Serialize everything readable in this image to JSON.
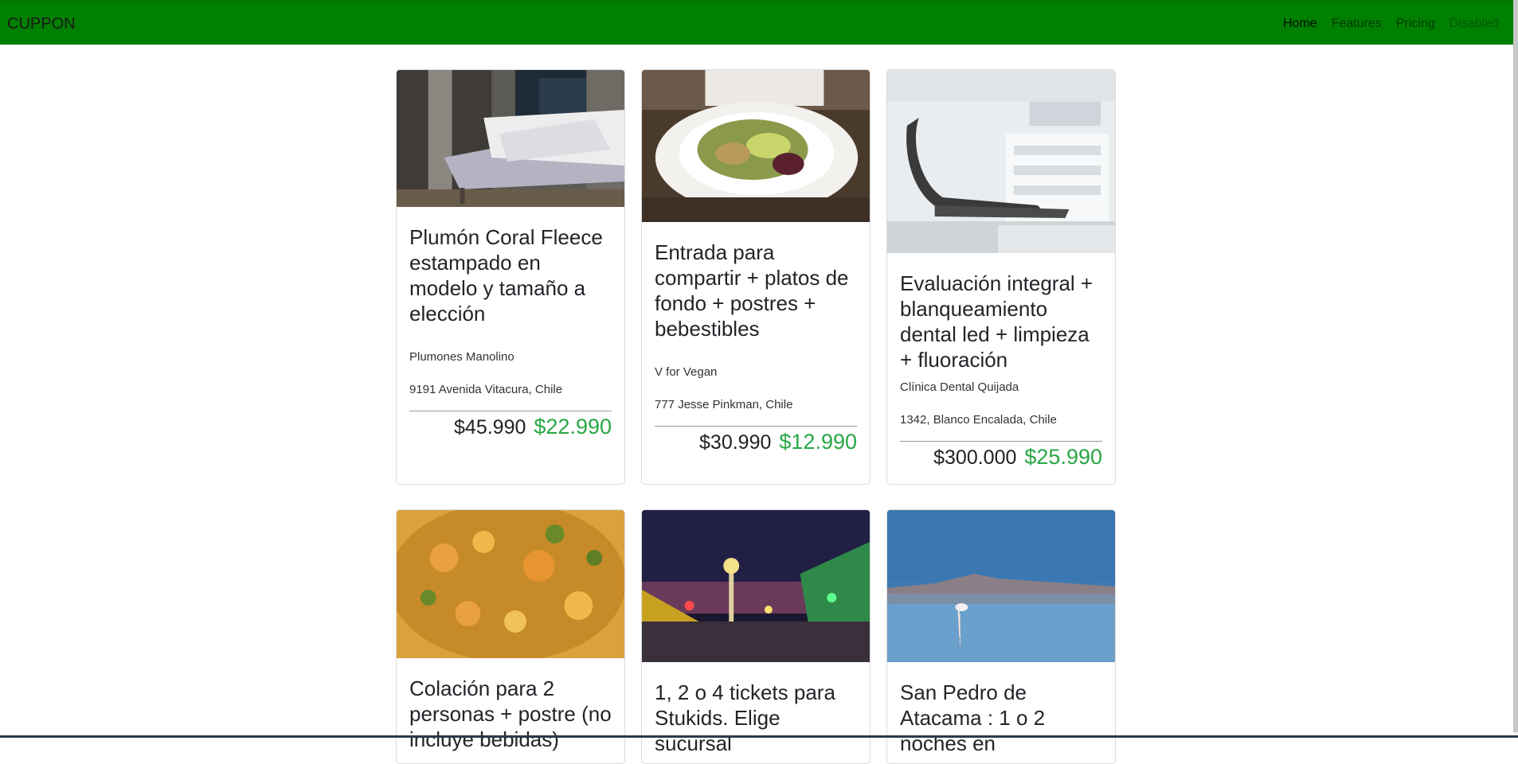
{
  "navbar": {
    "brand": "CUPPON",
    "links": [
      {
        "label": "Home",
        "state": "active"
      },
      {
        "label": "Features",
        "state": "normal"
      },
      {
        "label": "Pricing",
        "state": "normal"
      },
      {
        "label": "Disabled",
        "state": "disabled"
      }
    ],
    "bg_color": "#008000"
  },
  "deals": [
    {
      "title": "Plumón Coral Fleece estampado en modelo y tamaño a elección",
      "merchant": "Plumones Manolino",
      "address": "9191 Avenida Vitacura, Chile",
      "price_original": "$45.990",
      "price_discount": "$22.990",
      "image": "bedroom-photo"
    },
    {
      "title": "Entrada para compartir + platos de fondo + postres + bebestibles",
      "merchant": "V for Vegan",
      "address": "777 Jesse Pinkman, Chile",
      "price_original": "$30.990",
      "price_discount": "$12.990",
      "image": "vegan-salad-photo"
    },
    {
      "title": "Evaluación integral + blanqueamiento dental led + limpieza + fluoración",
      "merchant": "Clínica Dental Quijada",
      "address": "1342, Blanco Encalada, Chile",
      "price_original": "$300.000",
      "price_discount": "$25.990",
      "image": "dental-chair-photo"
    },
    {
      "title": "Colación para 2 personas + postre (no incluye bebidas)",
      "image": "food-dish-photo"
    },
    {
      "title": "1, 2 o 4 tickets para Stukids. Elige sucursal",
      "image": "amusement-park-photo"
    },
    {
      "title": "San Pedro de Atacama : 1 o 2 noches en",
      "image": "flamingo-lake-photo"
    }
  ],
  "colors": {
    "price_discount": "#28a745",
    "nav_bg": "#008000"
  }
}
